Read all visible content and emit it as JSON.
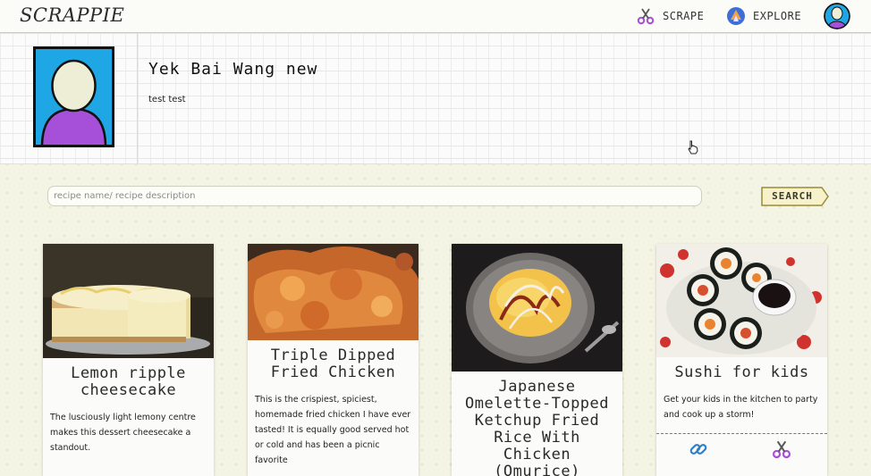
{
  "app": {
    "logo": "SCRAPPIE"
  },
  "nav": {
    "scrape": {
      "label": "SCRAPE",
      "icon": "scissors-icon"
    },
    "explore": {
      "label": "EXPLORE",
      "icon": "explore-icon"
    },
    "profile": {
      "icon": "user-avatar-icon"
    }
  },
  "profile": {
    "name": "Yek Bai Wang new",
    "bio": "test test",
    "avatar_icon": "user-avatar-icon"
  },
  "search": {
    "placeholder": "recipe name/ recipe description",
    "button_label": "SEARCH"
  },
  "recipes": [
    {
      "title": "Lemon ripple cheesecake",
      "description": "The lusciously light lemony centre makes this dessert cheesecake a standout."
    },
    {
      "title": "Triple Dipped Fried Chicken",
      "description": "This is the crispiest, spiciest, homemade fried chicken I have ever tasted! It is equally good served hot or cold and has been a picnic favorite"
    },
    {
      "title": "Japanese Omelette-Topped Ketchup Fried Rice With Chicken (Omurice)",
      "description": ""
    },
    {
      "title": "Sushi for kids",
      "description": "Get your kids in the kitchen to party and cook up a storm!",
      "actions": [
        "link-icon",
        "scissors-icon"
      ]
    }
  ],
  "colors": {
    "accent_purple": "#a64fd8",
    "avatar_blue": "#1ea7e4",
    "search_button_border": "#9a8b3a"
  }
}
